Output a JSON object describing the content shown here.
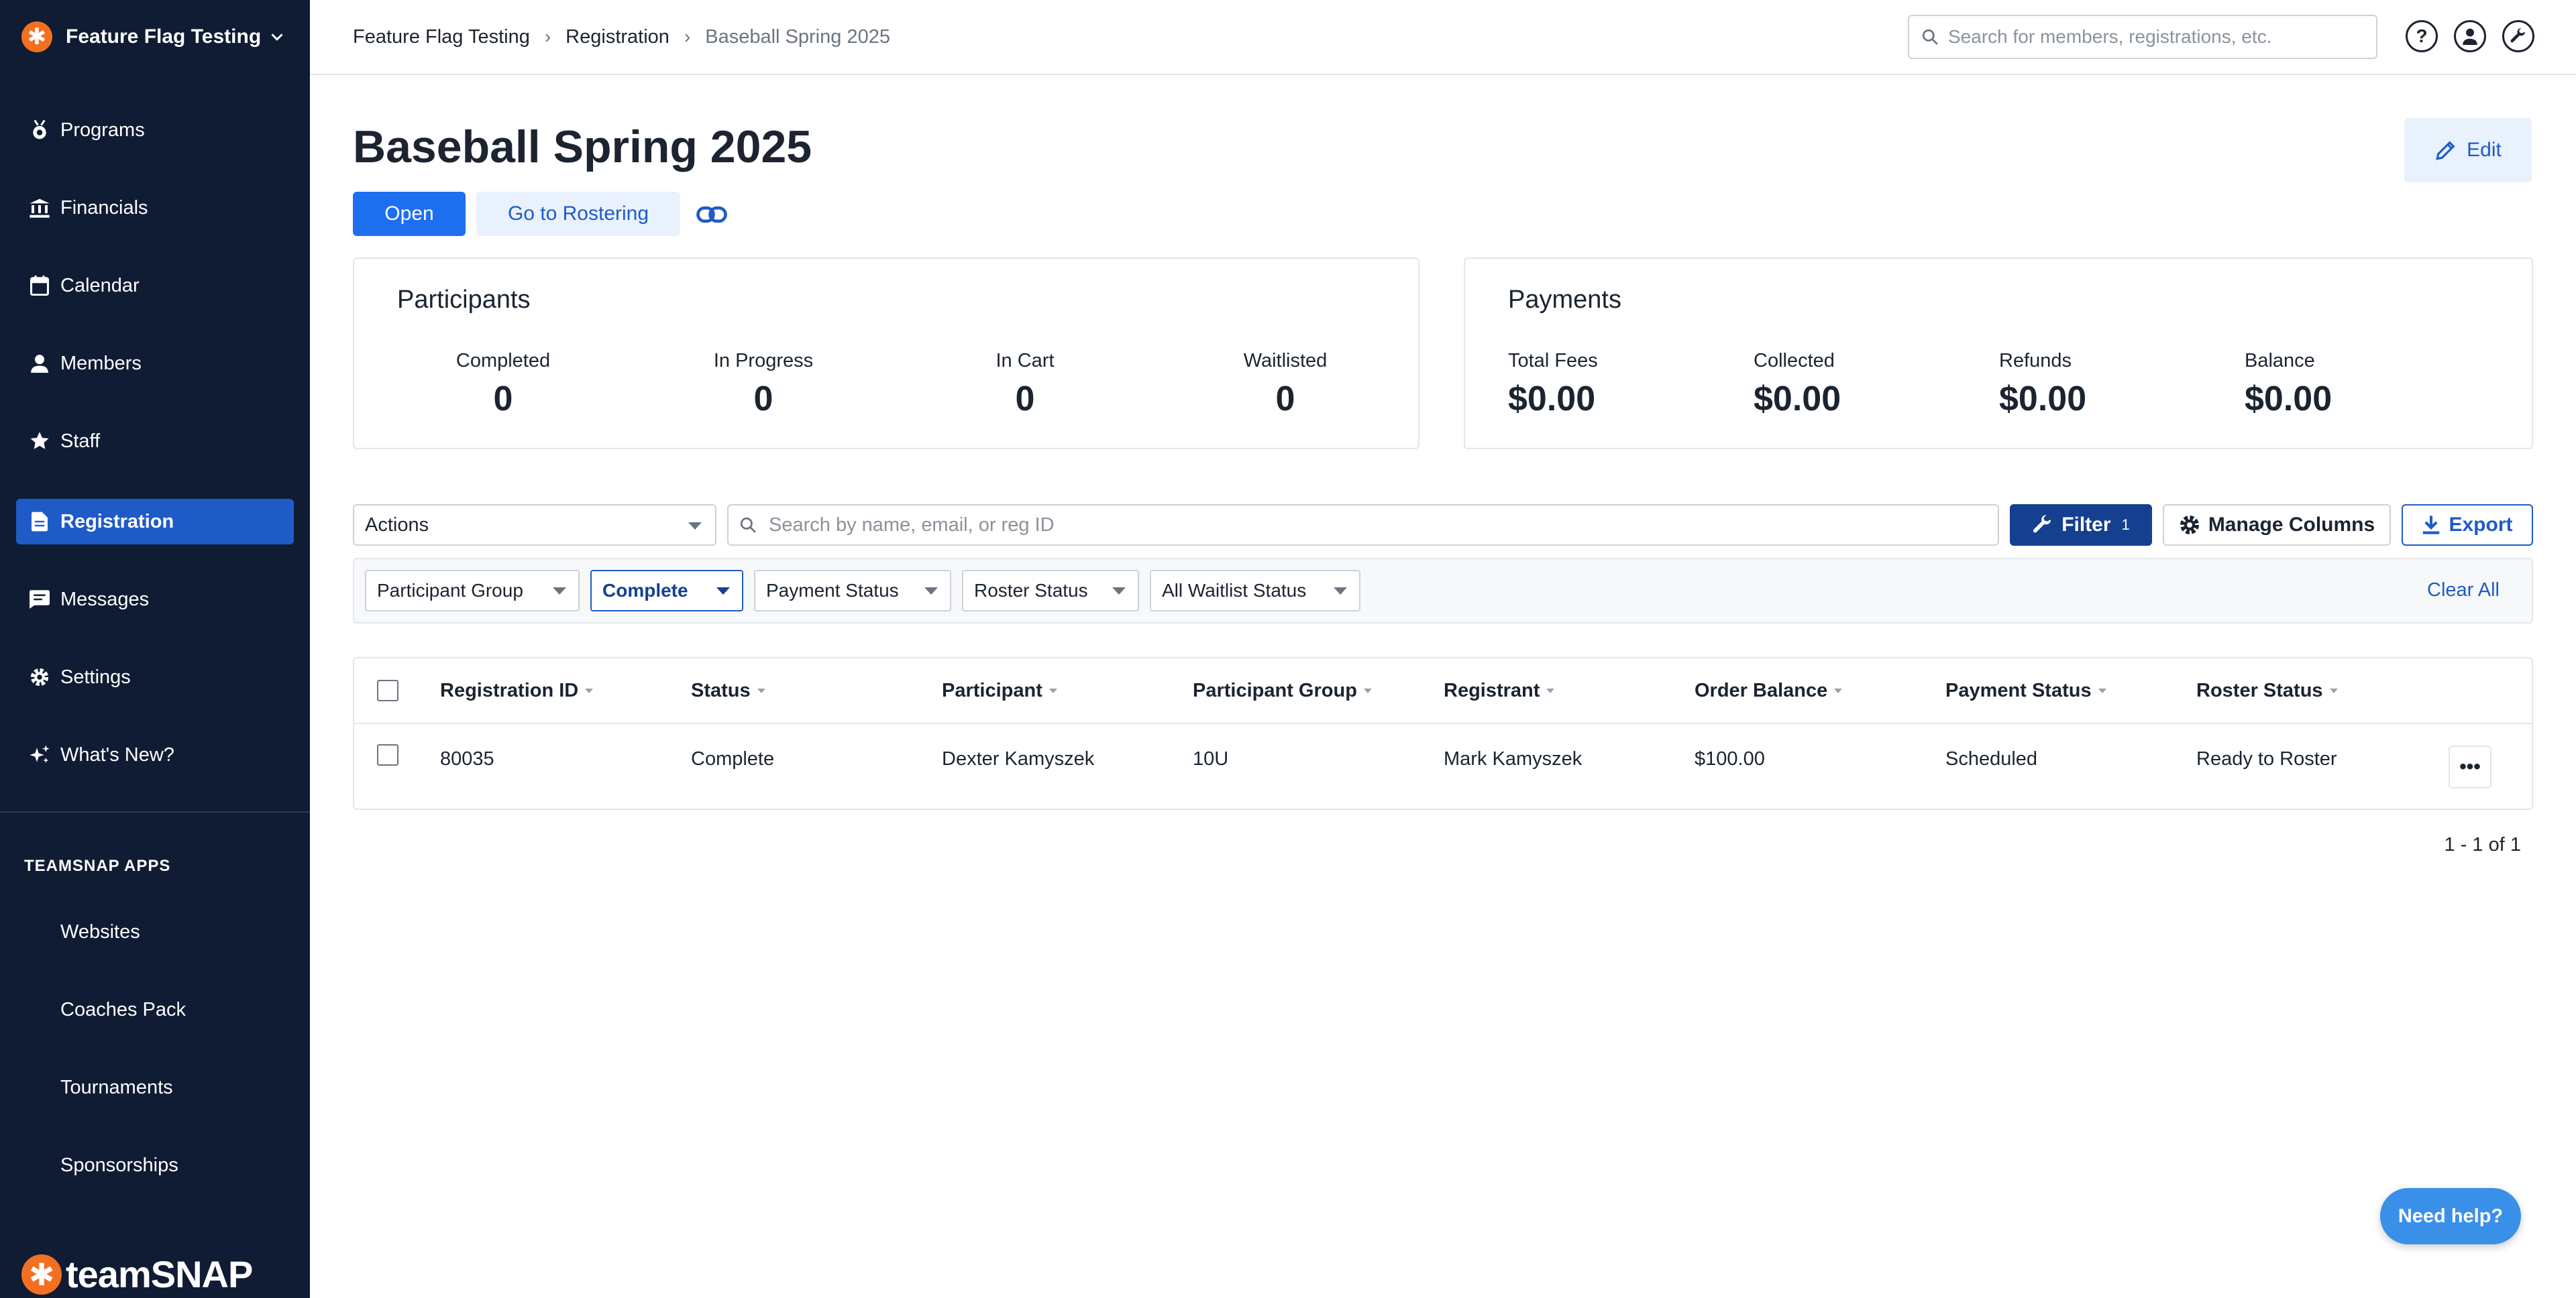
{
  "org": {
    "name": "Feature Flag Testing"
  },
  "sidebar": {
    "items": [
      {
        "label": "Programs",
        "icon": "programs-icon"
      },
      {
        "label": "Financials",
        "icon": "bank-icon"
      },
      {
        "label": "Calendar",
        "icon": "calendar-icon"
      },
      {
        "label": "Members",
        "icon": "person-icon"
      },
      {
        "label": "Staff",
        "icon": "star-icon"
      },
      {
        "label": "Registration",
        "icon": "document-icon",
        "active": true
      },
      {
        "label": "Messages",
        "icon": "message-icon"
      },
      {
        "label": "Settings",
        "icon": "gear-icon"
      },
      {
        "label": "What's New?",
        "icon": "sparkle-icon"
      }
    ],
    "apps_header": "TEAMSNAP APPS",
    "apps": [
      "Websites",
      "Coaches Pack",
      "Tournaments",
      "Sponsorships"
    ],
    "brand": "teamSNAP"
  },
  "breadcrumb": [
    "Feature Flag Testing",
    "Registration",
    "Baseball Spring 2025"
  ],
  "search": {
    "placeholder": "Search for members, registrations, etc."
  },
  "page": {
    "title": "Baseball Spring 2025",
    "edit_label": "Edit",
    "open_label": "Open",
    "rostering_label": "Go to Rostering"
  },
  "participants": {
    "title": "Participants",
    "stats": [
      {
        "label": "Completed",
        "value": "0"
      },
      {
        "label": "In Progress",
        "value": "0"
      },
      {
        "label": "In Cart",
        "value": "0"
      },
      {
        "label": "Waitlisted",
        "value": "0"
      }
    ]
  },
  "payments": {
    "title": "Payments",
    "stats": [
      {
        "label": "Total Fees",
        "value": "$0.00"
      },
      {
        "label": "Collected",
        "value": "$0.00"
      },
      {
        "label": "Refunds",
        "value": "$0.00"
      },
      {
        "label": "Balance",
        "value": "$0.00"
      }
    ]
  },
  "toolbar": {
    "actions_label": "Actions",
    "search_placeholder": "Search by name, email, or reg ID",
    "filter_label": "Filter",
    "filter_count": "1",
    "manage_columns_label": "Manage Columns",
    "export_label": "Export"
  },
  "filters": {
    "chips": [
      "Participant Group",
      "Complete",
      "Payment Status",
      "Roster Status",
      "All Waitlist Status"
    ],
    "clear_all": "Clear All"
  },
  "table": {
    "columns": [
      "Registration ID",
      "Status",
      "Participant",
      "Participant Group",
      "Registrant",
      "Order Balance",
      "Payment Status",
      "Roster Status"
    ],
    "rows": [
      [
        "80035",
        "Complete",
        "Dexter Kamyszek",
        "10U",
        "Mark Kamyszek",
        "$100.00",
        "Scheduled",
        "Ready to Roster"
      ]
    ],
    "more_label": "•••"
  },
  "pagination": "1 - 1 of 1",
  "help_label": "Need help?",
  "colors": {
    "sidebar": "#0f1c33",
    "accent": "#1e5bc6",
    "brand": "#f37021",
    "filter": "#15408f"
  }
}
